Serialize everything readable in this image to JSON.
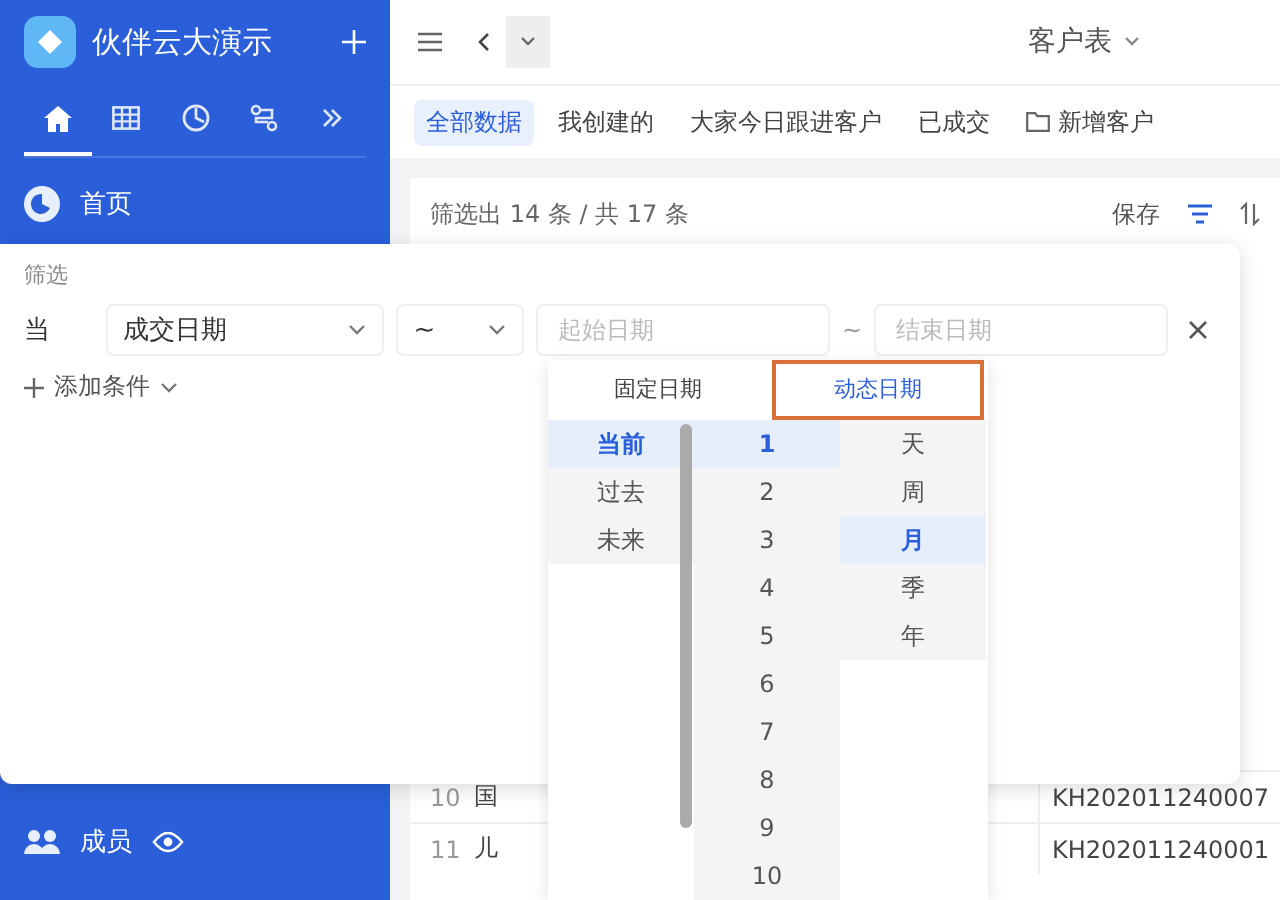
{
  "sidebar": {
    "app_name": "伙伴云大演示",
    "nav_icons": [
      {
        "kind": "home",
        "selected": true
      },
      {
        "kind": "table",
        "selected": false
      },
      {
        "kind": "chart",
        "selected": false
      },
      {
        "kind": "flow",
        "selected": false
      },
      {
        "kind": "more",
        "selected": false
      }
    ],
    "items": [
      {
        "kind": "home",
        "label": "首页"
      },
      {
        "kind": "members",
        "label": "成员"
      }
    ]
  },
  "main": {
    "title": "客户表",
    "views": [
      {
        "label": "全部数据",
        "selected": true
      },
      {
        "label": "我创建的",
        "selected": false
      },
      {
        "label": "大家今日跟进客户",
        "selected": false
      },
      {
        "label": "已成交",
        "selected": false
      },
      {
        "label": "新增客户",
        "selected": false,
        "kind": "folder"
      }
    ],
    "summary": "筛选出 14 条 / 共 17 条",
    "save": "保存",
    "rows": [
      {
        "index": "10",
        "name": "国",
        "code": "KH202011240007"
      },
      {
        "index": "11",
        "name": "儿",
        "code": "KH202011240001"
      }
    ]
  },
  "filter": {
    "title": "筛选",
    "prefix": "当",
    "field": "成交日期",
    "operator": "~",
    "start_placeholder": "起始日期",
    "separator": "~",
    "end_placeholder": "结束日期",
    "add": "添加条件"
  },
  "date_menu": {
    "tabs": [
      {
        "label": "固定日期",
        "selected": false
      },
      {
        "label": "动态日期",
        "selected": true
      }
    ],
    "columns": [
      [
        {
          "label": "当前",
          "selected": true
        },
        {
          "label": "过去",
          "selected": false
        },
        {
          "label": "未来",
          "selected": false
        }
      ],
      [
        {
          "label": "1",
          "selected": true
        },
        {
          "label": "2",
          "selected": false
        },
        {
          "label": "3",
          "selected": false
        },
        {
          "label": "4",
          "selected": false
        },
        {
          "label": "5",
          "selected": false
        },
        {
          "label": "6",
          "selected": false
        },
        {
          "label": "7",
          "selected": false
        },
        {
          "label": "8",
          "selected": false
        },
        {
          "label": "9",
          "selected": false
        },
        {
          "label": "10",
          "selected": false
        }
      ],
      [
        {
          "label": "天",
          "selected": false
        },
        {
          "label": "周",
          "selected": false
        },
        {
          "label": "月",
          "selected": true
        },
        {
          "label": "季",
          "selected": false
        },
        {
          "label": "年",
          "selected": false
        }
      ]
    ]
  }
}
